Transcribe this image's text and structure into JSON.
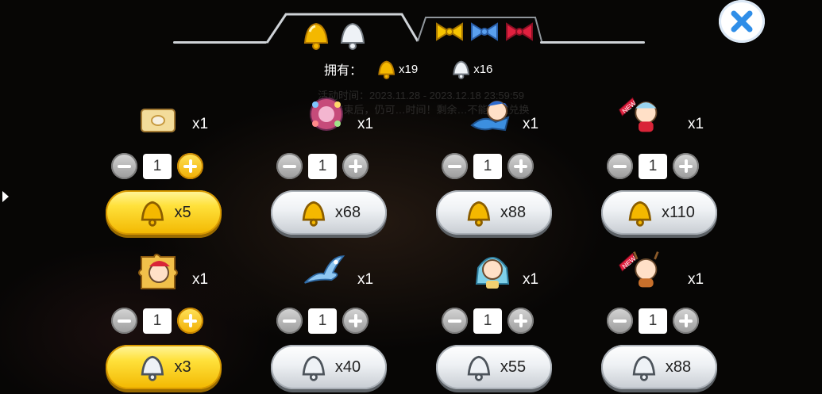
{
  "header": {
    "owned_label": "拥有：",
    "gold_count": "x19",
    "silver_count": "x16",
    "notice_line1": "活动时间：2023.11.28 - 2023.12.18 23:59:59",
    "notice_line2": "活动结束后，仍可…时间！剩余…不能再次兑换"
  },
  "items": [
    {
      "name": "scroll",
      "qty": "x1",
      "amount": "1",
      "price": "x5"
    },
    {
      "name": "firework-bouquet",
      "qty": "x1",
      "amount": "1",
      "price": "x68"
    },
    {
      "name": "mermaid-chibi",
      "qty": "x1",
      "amount": "1",
      "price": "x88"
    },
    {
      "name": "christmas-girl-new",
      "qty": "x1",
      "amount": "1",
      "price": "x110"
    },
    {
      "name": "santa-puzzle",
      "qty": "x1",
      "amount": "1",
      "price": "x3"
    },
    {
      "name": "blue-phoenix",
      "qty": "x1",
      "amount": "1",
      "price": "x40"
    },
    {
      "name": "blue-haired-girl",
      "qty": "x1",
      "amount": "1",
      "price": "x55"
    },
    {
      "name": "reindeer-girl-new",
      "qty": "x1",
      "amount": "1",
      "price": "x88"
    }
  ],
  "colors": {
    "gold": "#f7c400",
    "silver": "#e8ecf0",
    "close": "#2f8ee8",
    "accent_red": "#e0203f"
  },
  "icons": [
    "gold-bell-icon",
    "silver-bell-icon",
    "gold-bow-icon",
    "blue-bow-icon",
    "red-bow-icon",
    "close-icon",
    "minus-icon",
    "plus-icon"
  ]
}
